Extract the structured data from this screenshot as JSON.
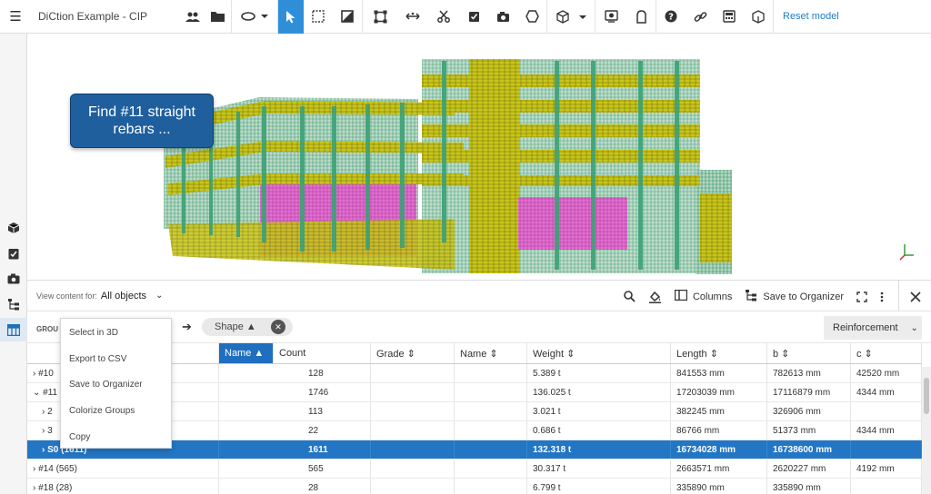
{
  "toolbar": {
    "menu_icon": "☰",
    "title": "DiCtion Example - CIP",
    "reset_label": "Reset model",
    "colors": {
      "active": "#2e8fd8",
      "link": "#1d7dc8"
    }
  },
  "viewport": {
    "callout": "Find #11 straight rebars ..."
  },
  "panel": {
    "view_label": "View content for:",
    "view_value": "All objects",
    "columns_label": "Columns",
    "organizer_label": "Save to Organizer"
  },
  "group_bar": {
    "label": "GROU",
    "chip": "Shape ▲",
    "reinforcement": "Reinforcement"
  },
  "context_menu": {
    "items": [
      "Select in 3D",
      "Export to CSV",
      "Save to Organizer",
      "Colorize Groups",
      "Copy"
    ]
  },
  "table": {
    "columns": [
      "Name ▲",
      "Count",
      "Grade ⇕",
      "Name ⇕",
      "Weight ⇕",
      "Length ⇕",
      "b ⇕",
      "c ⇕"
    ],
    "rows": [
      {
        "tree": "› #10",
        "count": "128",
        "grade": "",
        "name": "",
        "weight": "5.389 t",
        "length": "841553 mm",
        "b": "782613 mm",
        "c": "42520 mm"
      },
      {
        "tree": "⌄ #11",
        "count": "1746",
        "grade": "",
        "name": "",
        "weight": "136.025 t",
        "length": "17203039 mm",
        "b": "17116879 mm",
        "c": "4344 mm"
      },
      {
        "tree": "› 2",
        "count": "113",
        "grade": "",
        "name": "",
        "weight": "3.021 t",
        "length": "382245 mm",
        "b": "326906 mm",
        "c": ""
      },
      {
        "tree": "› 3",
        "count": "22",
        "grade": "",
        "name": "",
        "weight": "0.686 t",
        "length": "86766 mm",
        "b": "51373 mm",
        "c": "4344 mm"
      },
      {
        "tree": "› S0 (1611)",
        "count": "1611",
        "grade": "",
        "name": "",
        "weight": "132.318 t",
        "length": "16734028 mm",
        "b": "16738600 mm",
        "c": ""
      },
      {
        "tree": "› #14 (565)",
        "count": "565",
        "grade": "",
        "name": "",
        "weight": "30.317 t",
        "length": "2663571 mm",
        "b": "2620227 mm",
        "c": "4192 mm"
      },
      {
        "tree": "› #18 (28)",
        "count": "28",
        "grade": "",
        "name": "",
        "weight": "6.799 t",
        "length": "335890 mm",
        "b": "335890 mm",
        "c": ""
      }
    ]
  }
}
